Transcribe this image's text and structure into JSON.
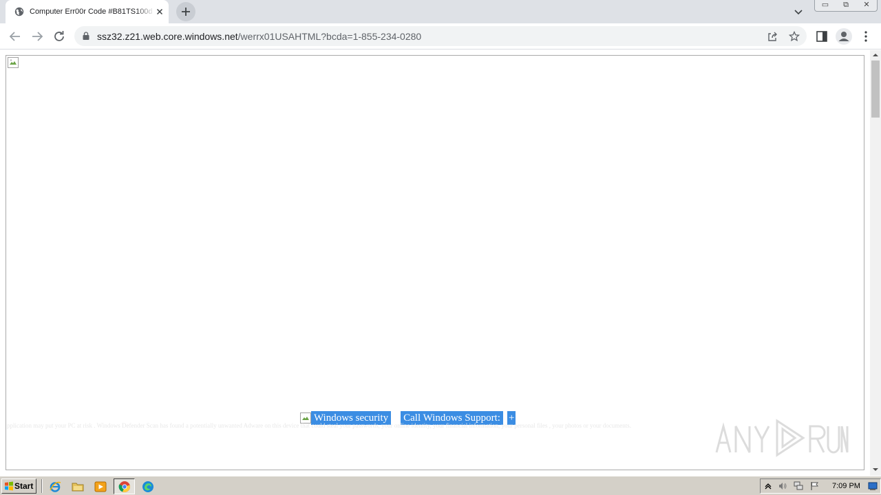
{
  "browser": {
    "tab_title": "Computer Err00r Code #B81TS100d",
    "url_host": "ssz32.z21.web.core.windows.net",
    "url_path": "/werrx01USAHTML?bcda=1-855-234-0280",
    "new_tab_label": "+",
    "icons": [
      "globe-icon",
      "close-icon",
      "plus-icon",
      "chevron-down-icon",
      "minimize-icon",
      "restore-icon",
      "back-arrow-icon",
      "forward-arrow-icon",
      "reload-icon",
      "lock-icon",
      "share-icon",
      "star-icon",
      "side-panel-icon",
      "profile-icon",
      "kebab-menu-icon"
    ]
  },
  "page": {
    "button_windows_security": "Windows security",
    "button_call_support": "Call Windows Support:",
    "button_plus": "+",
    "faint_text": "pplication may put your PC at risk . Windows Defender Scan has found a potentially unwanted Adware on this device that could steal your passwords, your online identity, your financial information, your personal files , your photos or your documents."
  },
  "watermark": {
    "text": "ANY.RUN"
  },
  "taskbar": {
    "start_label": "Start",
    "clock": "7:09 PM",
    "icons": [
      "windows-flag-icon",
      "internet-explorer-icon",
      "folder-icon",
      "media-player-icon",
      "chrome-icon",
      "edge-icon",
      "tray-expand-icon",
      "volume-icon",
      "network-icon",
      "flag-icon",
      "show-desktop-icon"
    ]
  }
}
